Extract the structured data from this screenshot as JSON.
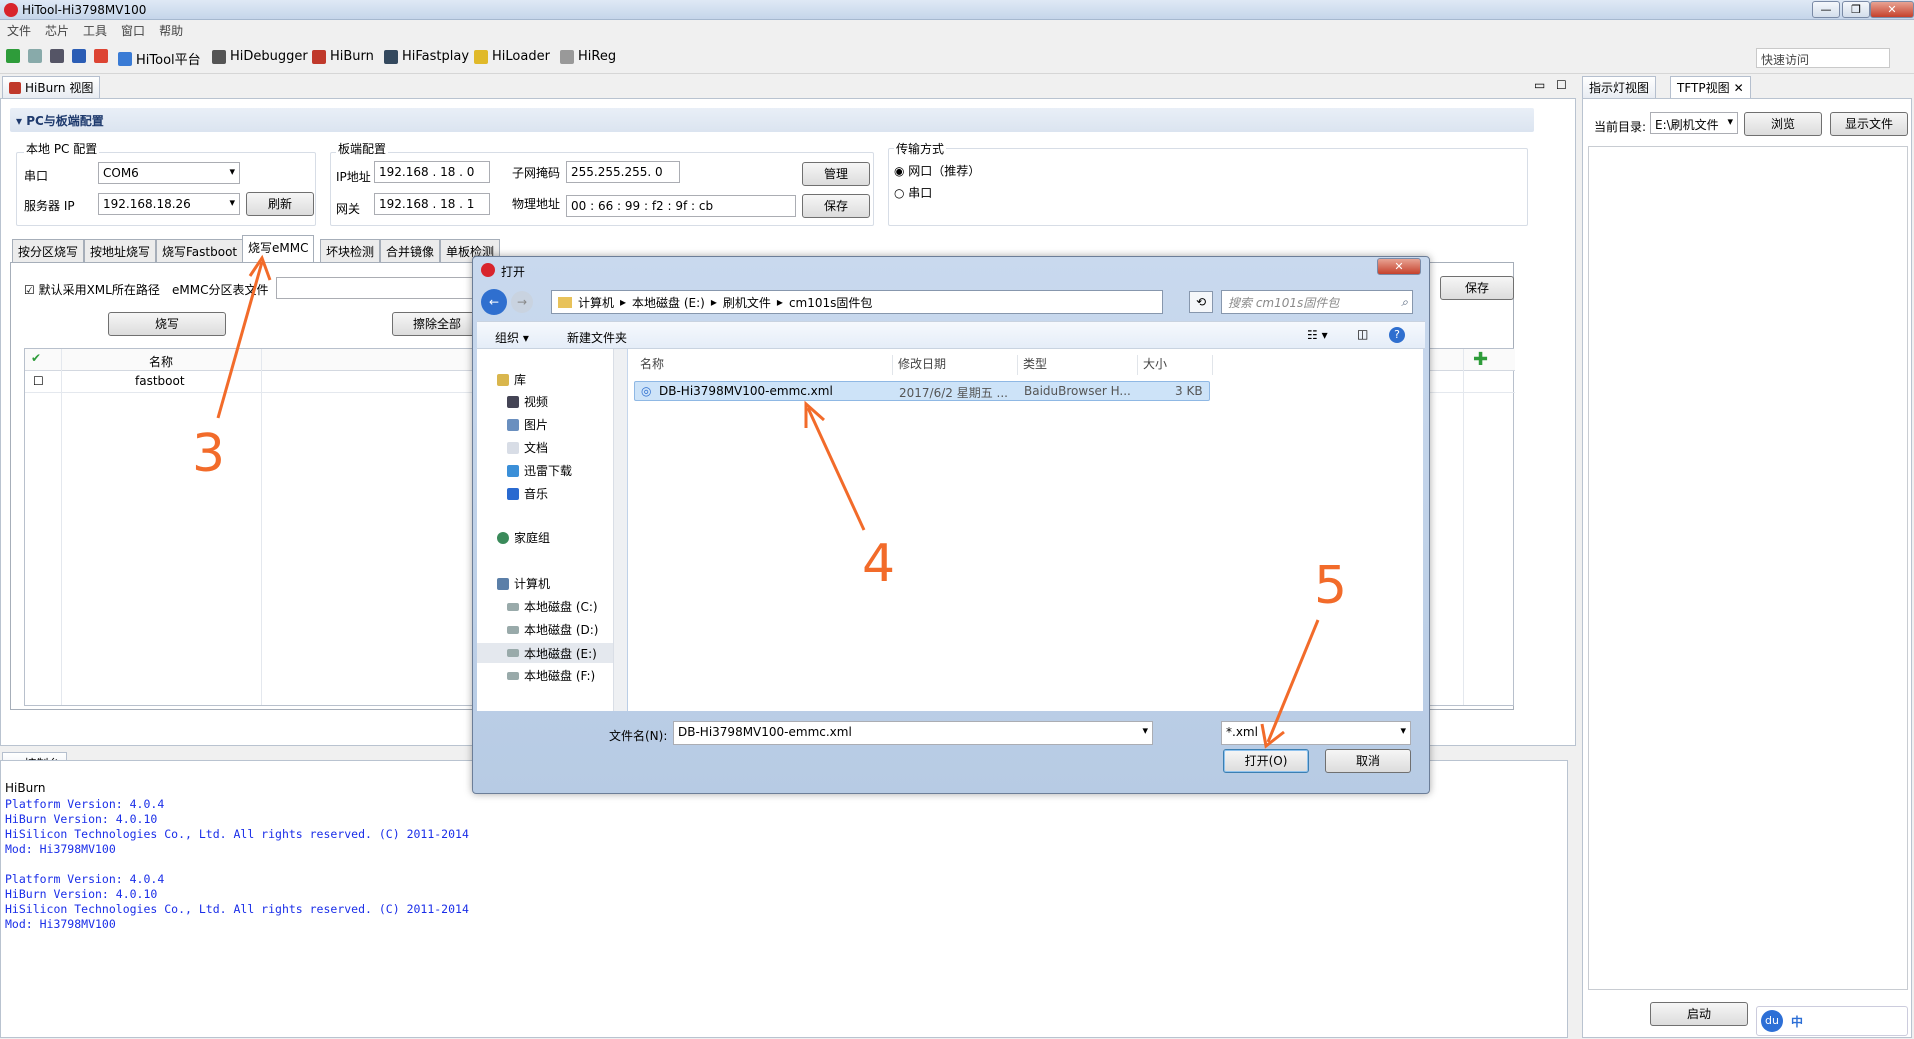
{
  "window": {
    "title": "HiTool-Hi3798MV100"
  },
  "menu": [
    "文件",
    "芯片",
    "工具",
    "窗口",
    "帮助"
  ],
  "toolbar": {
    "items": [
      "HiTool平台",
      "HiDebugger",
      "HiBurn",
      "HiFastplay",
      "HiLoader",
      "HiReg"
    ],
    "quick_access": "快速访问"
  },
  "hiburn": {
    "view_tab": "HiBurn 视图",
    "section_title": "PC与板端配置",
    "local_pc": {
      "title": "本地 PC 配置",
      "serial_label": "串口",
      "serial_value": "COM6",
      "server_ip_label": "服务器 IP",
      "server_ip_value": "192.168.18.26",
      "refresh": "刷新"
    },
    "board": {
      "title": "板端配置",
      "ip_label": "IP地址",
      "ip_value": "192.168 . 18 . 0",
      "gateway_label": "网关",
      "gateway_value": "192.168 . 18 . 1",
      "mask_label": "子网掩码",
      "mask_value": "255.255.255. 0",
      "mac_label": "物理地址",
      "mac_value": "00  :  66  :  99  :  f2  :  9f  :  cb",
      "manage": "管理",
      "save": "保存"
    },
    "transfer": {
      "title": "传输方式",
      "opt1": "网口（推荐）",
      "opt2": "串口"
    },
    "tabs": [
      "按分区烧写",
      "按地址烧写",
      "烧写Fastboot",
      "烧写eMMC",
      "坏块检测",
      "合并镜像",
      "单板检测"
    ],
    "emmc": {
      "use_xml": "默认采用XML所在路径",
      "file_label": "eMMC分区表文件",
      "burn": "烧写",
      "erase": "擦除全部",
      "save": "保存"
    },
    "table": {
      "col_name": "名称",
      "rows": [
        "fastboot"
      ]
    }
  },
  "console": {
    "tab": "控制台",
    "sub": "HiBurn",
    "lines": [
      "Platform Version: 4.0.4",
      "HiBurn Version: 4.0.10",
      "HiSilicon Technologies Co., Ltd. All rights reserved. (C) 2011-2014",
      "Mod: Hi3798MV100",
      "",
      "Platform Version: 4.0.4",
      "HiBurn Version: 4.0.10",
      "HiSilicon Technologies Co., Ltd. All rights reserved. (C) 2011-2014",
      "Mod: Hi3798MV100"
    ]
  },
  "right_panel": {
    "tab1": "指示灯视图",
    "tab2": "TFTP视图",
    "dir_label": "当前目录:",
    "dir_value": "E:\\刷机文件",
    "browse": "浏览",
    "show_files": "显示文件",
    "start": "启动"
  },
  "dialog": {
    "title": "打开",
    "path": [
      "计算机",
      "本地磁盘 (E:)",
      "刷机文件",
      "cm101s固件包"
    ],
    "search_placeholder": "搜索 cm101s固件包",
    "organize": "组织 ▾",
    "new_folder": "新建文件夹",
    "nav": [
      "库",
      "视频",
      "图片",
      "文档",
      "迅雷下载",
      "音乐",
      "家庭组",
      "计算机",
      "本地磁盘 (C:)",
      "本地磁盘 (D:)",
      "本地磁盘 (E:)",
      "本地磁盘 (F:)"
    ],
    "columns": [
      "名称",
      "修改日期",
      "类型",
      "大小"
    ],
    "file": {
      "name": "DB-Hi3798MV100-emmc.xml",
      "date": "2017/6/2 星期五 ...",
      "type": "BaiduBrowser H...",
      "size": "3 KB"
    },
    "filename_label": "文件名(N):",
    "filename_value": "DB-Hi3798MV100-emmc.xml",
    "filter": "*.xml",
    "open": "打开(O)",
    "cancel": "取消"
  },
  "annotations": [
    "3",
    "4",
    "5"
  ],
  "taskbar": {
    "ime": "中"
  },
  "colors": {
    "accent": "#f26b2a",
    "console_text": "#1a2ee8"
  }
}
